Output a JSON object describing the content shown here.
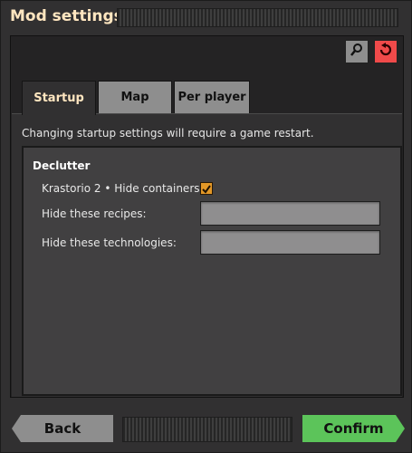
{
  "window": {
    "title": "Mod settings"
  },
  "toolbar": {
    "search_icon": "search-icon",
    "reset_icon": "reset-icon"
  },
  "tabs": [
    {
      "label": "Startup",
      "active": true
    },
    {
      "label": "Map",
      "active": false
    },
    {
      "label": "Per player",
      "active": false
    }
  ],
  "hint": "Changing startup settings will require a game restart.",
  "section": {
    "title": "Declutter",
    "settings": [
      {
        "label": "Krastorio 2 • Hide containers",
        "type": "checkbox",
        "checked": true
      },
      {
        "label": "Hide these recipes:",
        "type": "text",
        "value": ""
      },
      {
        "label": "Hide these technologies:",
        "type": "text",
        "value": ""
      }
    ]
  },
  "footer": {
    "back_label": "Back",
    "confirm_label": "Confirm"
  },
  "colors": {
    "title": "#ffe6c0",
    "confirm": "#5cc45a",
    "reset": "#f04a4a",
    "checkbox": "#e39827"
  }
}
